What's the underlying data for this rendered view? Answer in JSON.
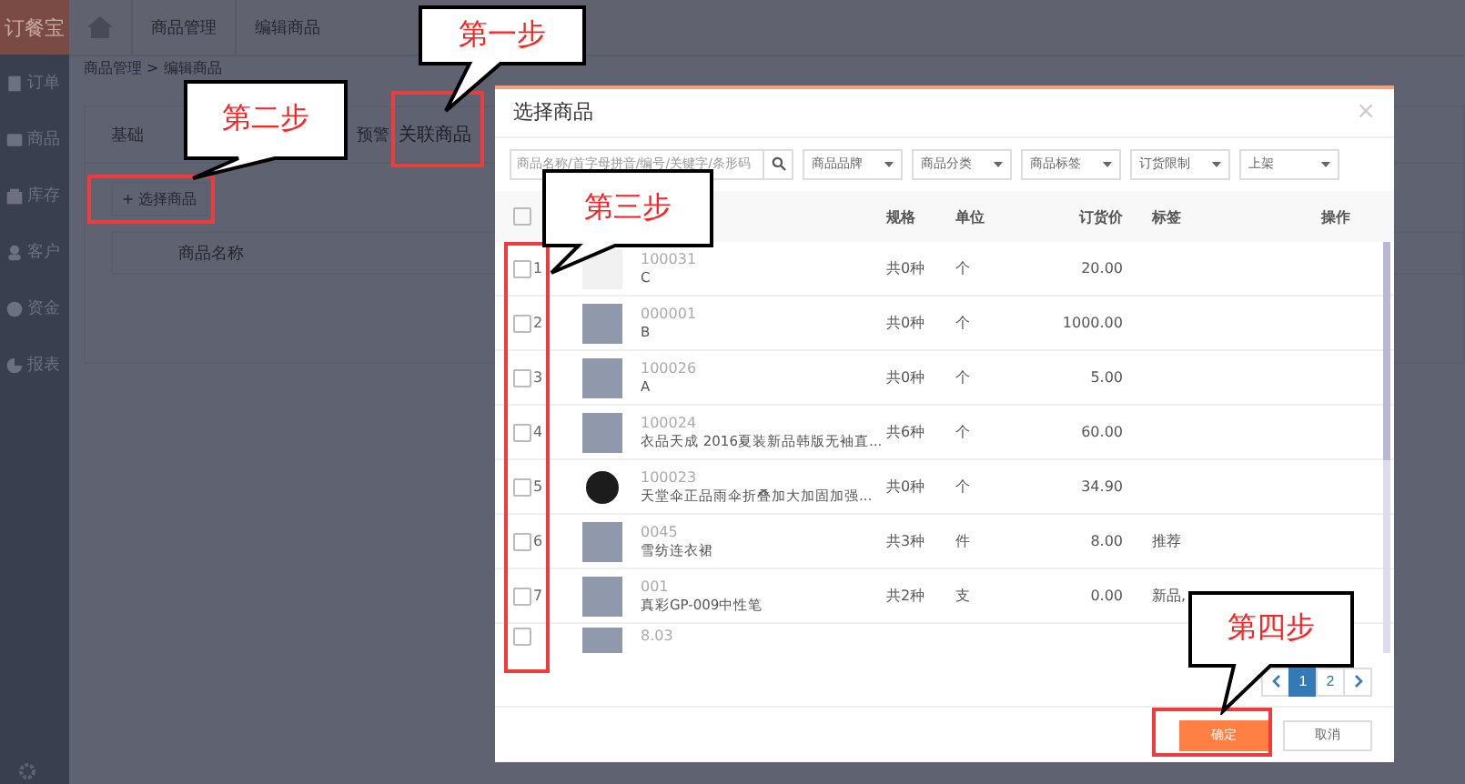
{
  "sidebar": {
    "logo": "订餐宝",
    "items": [
      {
        "label": "订单"
      },
      {
        "label": "商品"
      },
      {
        "label": "库存"
      },
      {
        "label": "客户"
      },
      {
        "label": "资金"
      },
      {
        "label": "报表"
      }
    ]
  },
  "topbar": {
    "tabs": [
      "商品管理",
      "编辑商品"
    ]
  },
  "breadcrumb": "商品管理 > 编辑商品",
  "edit_tabs": [
    {
      "label": "基础",
      "selected": false
    },
    {
      "label": "预警",
      "selected": false
    },
    {
      "label": "关联商品",
      "selected": true
    }
  ],
  "select_button": "+ 选择商品",
  "related_table": {
    "columns": [
      "商品名称"
    ]
  },
  "dialog": {
    "title": "选择商品",
    "close": "×",
    "search": {
      "placeholder": "商品名称/首字母拼音/编号/关键字/条形码"
    },
    "filters": [
      "商品品牌",
      "商品分类",
      "商品标签",
      "订货限制",
      "上架"
    ],
    "all_checked": false,
    "columns": [
      "规格",
      "单位",
      "订货价",
      "标签",
      "操作"
    ],
    "rows": [
      {
        "index": "1",
        "code": "100031",
        "name": "C",
        "spec": "共0种",
        "unit": "个",
        "price": "20.00",
        "tags": "",
        "checked": false
      },
      {
        "index": "2",
        "code": "000001",
        "name": "B",
        "spec": "共0种",
        "unit": "个",
        "price": "1000.00",
        "tags": "",
        "checked": false
      },
      {
        "index": "3",
        "code": "100026",
        "name": "A",
        "spec": "共0种",
        "unit": "个",
        "price": "5.00",
        "tags": "",
        "checked": false
      },
      {
        "index": "4",
        "code": "100024",
        "name": "衣品天成 2016夏装新品韩版无袖直...",
        "spec": "共6种",
        "unit": "个",
        "price": "60.00",
        "tags": "",
        "checked": false
      },
      {
        "index": "5",
        "code": "100023",
        "name": "天堂伞正品雨伞折叠加大加固加强...",
        "spec": "共0种",
        "unit": "个",
        "price": "34.90",
        "tags": "",
        "checked": false
      },
      {
        "index": "6",
        "code": "0045",
        "name": "雪纺连衣裙",
        "spec": "共3种",
        "unit": "件",
        "price": "8.00",
        "tags": "推荐",
        "checked": false
      },
      {
        "index": "7",
        "code": "001",
        "name": "真彩GP-009中性笔",
        "spec": "共2种",
        "unit": "支",
        "price": "0.00",
        "tags": "新品,",
        "checked": false
      },
      {
        "code": "8.03",
        "checked": false
      }
    ],
    "pages": [
      {
        "label": "1",
        "selected": true
      },
      {
        "label": "2",
        "selected": false
      }
    ],
    "ok": "确定",
    "cancel": "取消"
  },
  "callouts": [
    {
      "text": "第一步"
    },
    {
      "text": "第二步"
    },
    {
      "text": "第三步"
    },
    {
      "text": "第四步"
    }
  ]
}
